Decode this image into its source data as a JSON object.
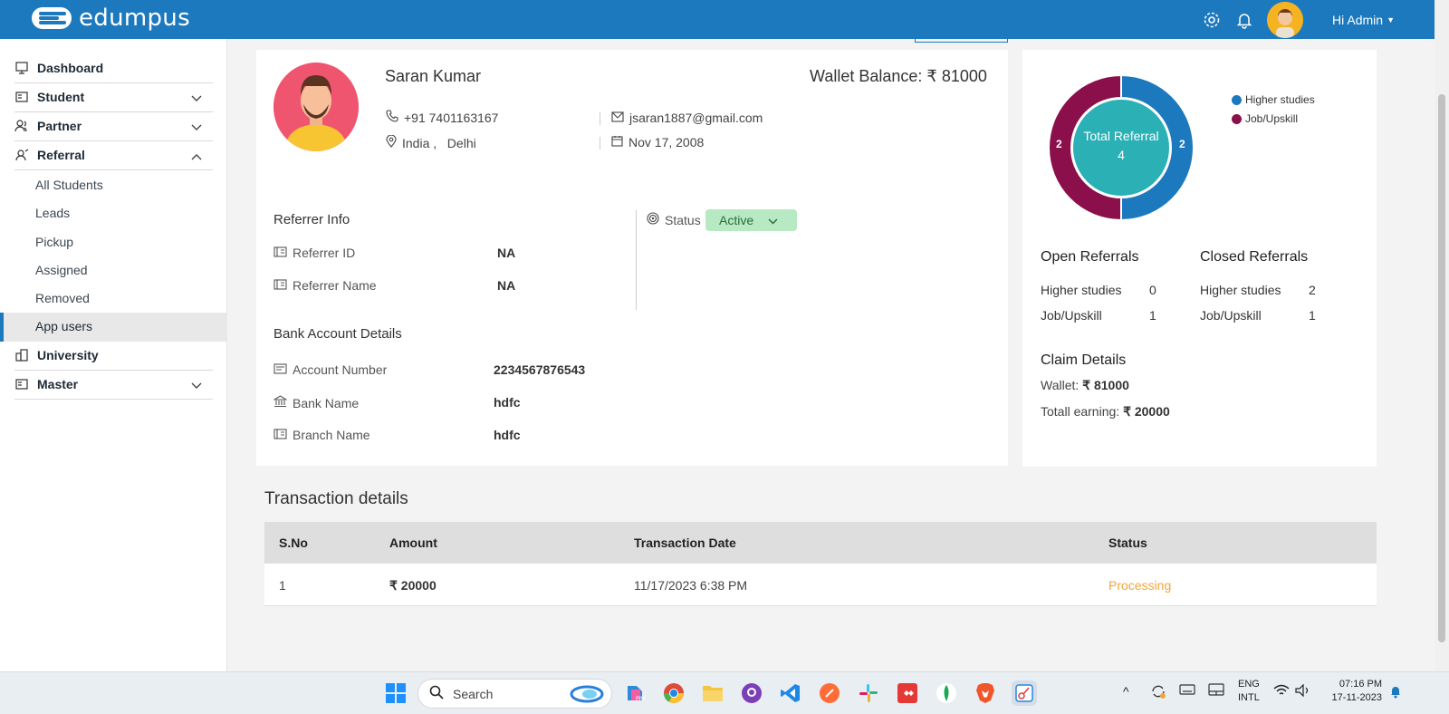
{
  "app": {
    "brand": "edumpus",
    "greeting": "Hi Admin"
  },
  "sidebar": {
    "items": [
      {
        "label": "Dashboard"
      },
      {
        "label": "Student"
      },
      {
        "label": "Partner"
      },
      {
        "label": "Referral"
      },
      {
        "label": "University"
      },
      {
        "label": "Master"
      }
    ],
    "referral_sub": [
      {
        "label": "All Students"
      },
      {
        "label": "Leads"
      },
      {
        "label": "Pickup"
      },
      {
        "label": "Assigned"
      },
      {
        "label": "Removed"
      },
      {
        "label": "App users"
      }
    ]
  },
  "profile": {
    "name": "Saran Kumar",
    "wallet_balance": "Wallet Balance: ₹ 81000",
    "phone": "+91 7401163167",
    "email": "jsaran1887@gmail.com",
    "location": "India ,   Delhi",
    "dob": "Nov 17, 2008"
  },
  "referrer_info": {
    "title": "Referrer Info",
    "id_label": "Referrer ID",
    "id_value": "NA",
    "name_label": "Referrer Name",
    "name_value": "NA"
  },
  "status": {
    "label": "Status",
    "value": "Active"
  },
  "bank": {
    "title": "Bank Account Details",
    "account_label": "Account Number",
    "account_value": "2234567876543",
    "bank_label": "Bank Name",
    "bank_value": "hdfc",
    "branch_label": "Branch Name",
    "branch_value": "hdfc"
  },
  "referral_chart": {
    "center_title": "Total Referral",
    "center_value": "4",
    "left_label": "2",
    "right_label": "2",
    "legend": [
      {
        "name": "Higher studies",
        "color": "#1d79bd"
      },
      {
        "name": "Job/Upskill",
        "color": "#8b0f4a"
      }
    ]
  },
  "open_referrals": {
    "title": "Open Referrals",
    "rows": [
      {
        "label": "Higher studies",
        "value": "0"
      },
      {
        "label": "Job/Upskill",
        "value": "1"
      }
    ]
  },
  "closed_referrals": {
    "title": "Closed Referrals",
    "rows": [
      {
        "label": "Higher studies",
        "value": "2"
      },
      {
        "label": "Job/Upskill",
        "value": "1"
      }
    ]
  },
  "claim": {
    "title": "Claim Details",
    "wallet_label": "Wallet:",
    "wallet_value": "₹ 81000",
    "earning_label": "Totall earning:",
    "earning_value": "₹ 20000"
  },
  "transactions": {
    "title": "Transaction details",
    "columns": [
      "S.No",
      "Amount",
      "Transaction Date",
      "Status"
    ],
    "rows": [
      {
        "sno": "1",
        "amount": "₹ 20000",
        "date": "11/17/2023 6:38 PM",
        "status": "Processing"
      }
    ]
  },
  "taskbar": {
    "search_placeholder": "Search",
    "lang_top": "ENG",
    "lang_bottom": "INTL",
    "time": "07:16 PM",
    "date": "17-11-2023"
  },
  "colors": {
    "brand": "#1d79bd",
    "accent_maroon": "#8b0f4a",
    "status_processing": "#f0a53a"
  }
}
